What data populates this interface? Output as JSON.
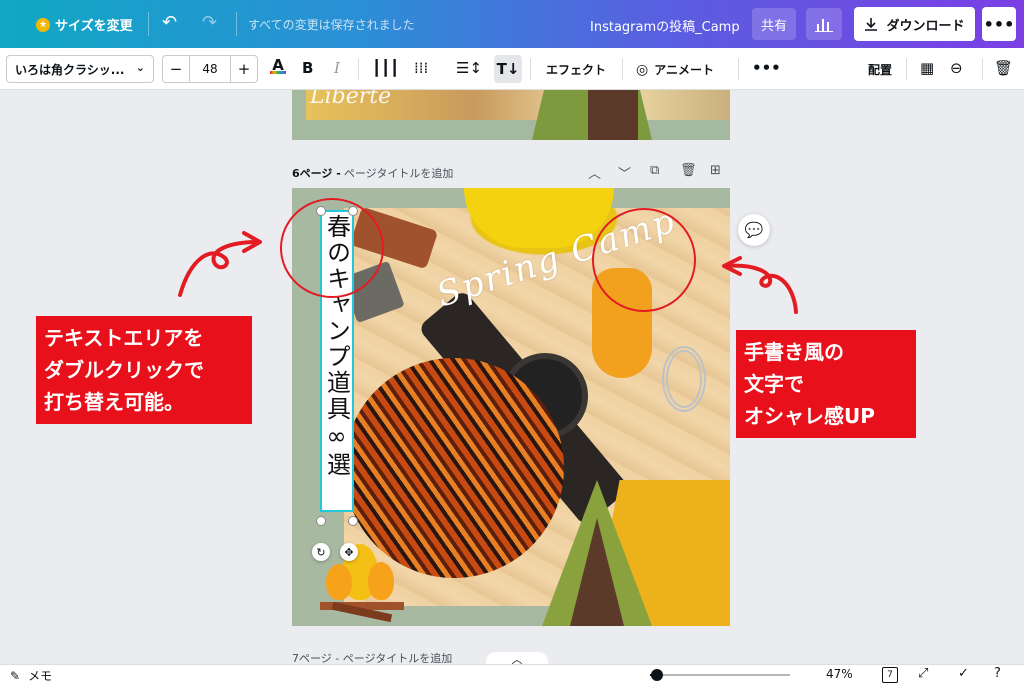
{
  "topbar": {
    "resize_label": "サイズを変更",
    "saved_status": "すべての変更は保存されました",
    "doc_title": "Instagramの投稿_Camp",
    "share_label": "共有",
    "download_label": "ダウンロード",
    "more_label": "•••"
  },
  "toolbar": {
    "font_name": "いろは角クラシッ...",
    "font_size": "48",
    "minus": "−",
    "plus": "+",
    "effects_label": "エフェクト",
    "animate_label": "アニメート",
    "more_label": "•••",
    "position_label": "配置"
  },
  "pages": {
    "page6_number": "6ページ -",
    "page6_title_placeholder": "ページタイトルを追加",
    "page7_label": "7ページ - ページタイトルを追加"
  },
  "design": {
    "vertical_text": "春のキャンプ道具∞選",
    "script_text": "Spring Camp",
    "prev_page_script": "Liberté"
  },
  "annotations": {
    "left_callout": [
      "テキストエリアを",
      "ダブルクリックで",
      "打ち替え可能。"
    ],
    "right_callout": [
      "手書き風の",
      "文字で",
      "オシャレ感UP"
    ],
    "accent_color": "#e8101a"
  },
  "bottombar": {
    "notes_label": "メモ",
    "zoom": "47%",
    "page_count": "7",
    "zoom_fraction": 0.05
  },
  "icons": {
    "crown": "crown-icon",
    "undo": "undo-icon",
    "redo": "redo-icon",
    "chart": "chart-icon",
    "download": "download-icon",
    "comment": "comment-add-icon"
  }
}
